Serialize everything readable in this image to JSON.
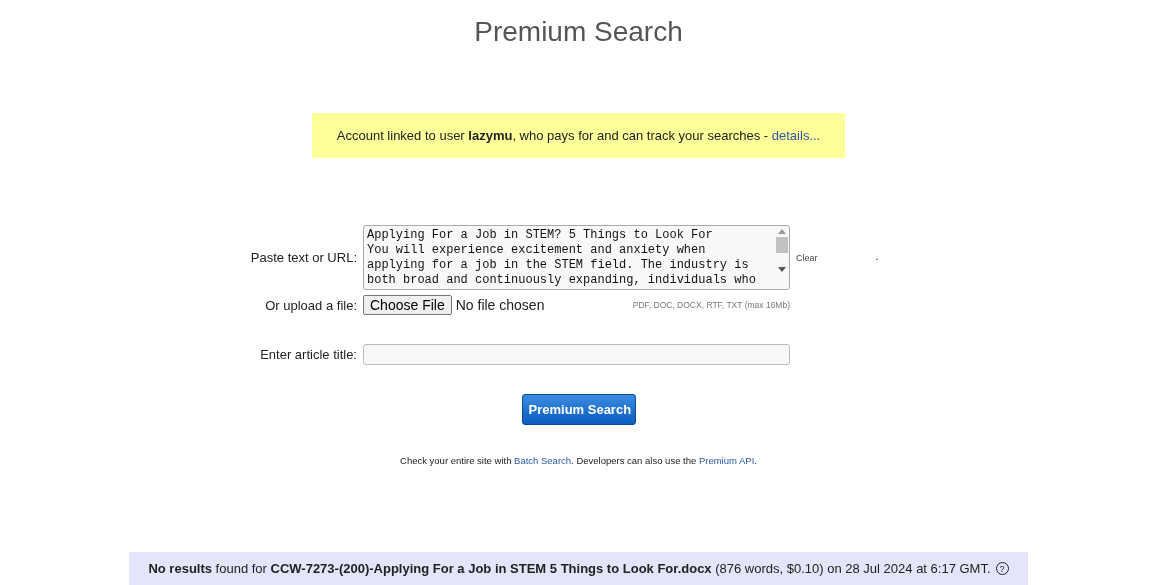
{
  "title": "Premium Search",
  "notice": {
    "text": "Account linked to user **lazymu**, who pays for and can track your searches - ",
    "link": "details..."
  },
  "form": {
    "paste_label": "Paste text or URL:",
    "paste_lines": [
      "Applying For a Job in STEM? 5 Things to Look For",
      "You will experience excitement and anxiety when",
      "applying for a job in the STEM field. The industry is",
      "both broad and continuously expanding, individuals who"
    ],
    "clear_link": "Clear",
    "trailing_mark": ".",
    "upload_label": "Or upload a file:",
    "upload_button": "Choose File",
    "upload_status": "No file chosen",
    "upload_formats": "PDF, DOC, DOCX, RTF, TXT (max 16Mb)",
    "title_label": "Enter article title:",
    "submit": "Premium Search"
  },
  "info": {
    "before": "Check your entire site with ",
    "link1": "Batch Search",
    "middle": ". Developers can also use the ",
    "link2": "Premium API",
    "after": "."
  },
  "result_bar": {
    "text": "**No results** found for **CCW-7273-(200)-Applying For a Job in STEM 5 Things to Look For.docx** (876 words, $0.10) on 28 Jul 2024 at 6:17 GMT.",
    "help": "?"
  }
}
